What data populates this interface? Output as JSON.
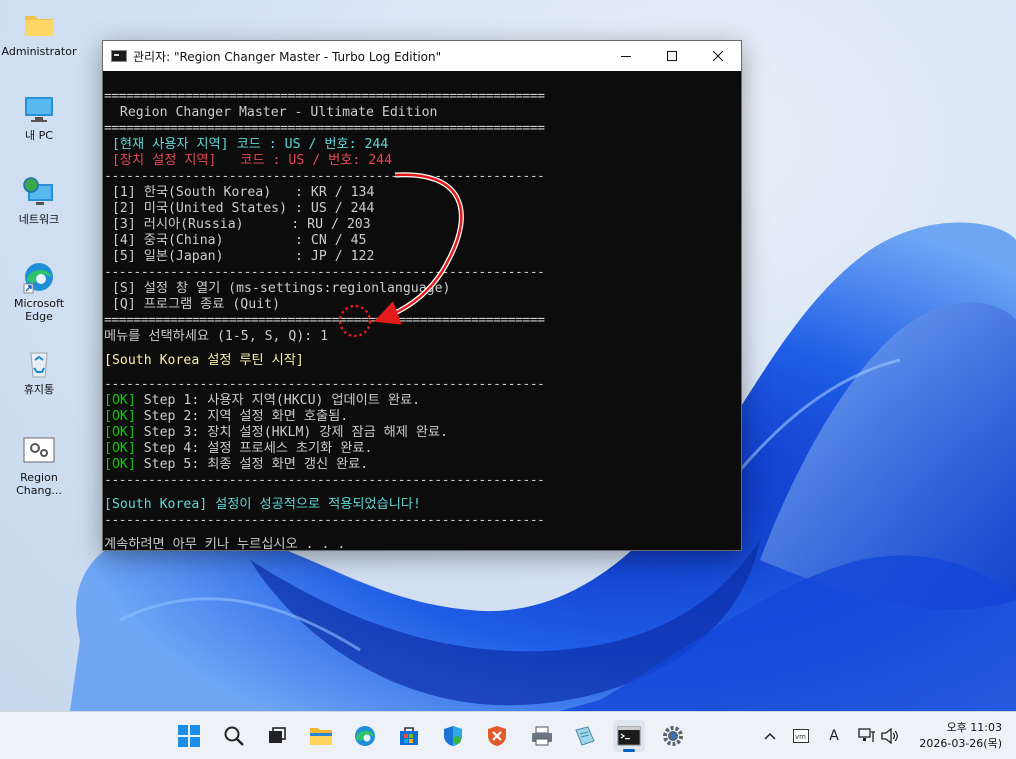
{
  "desktop": {
    "icons": [
      {
        "label": "Administrator"
      },
      {
        "label": "내 PC"
      },
      {
        "label": "네트워크"
      },
      {
        "label": "Microsoft Edge"
      },
      {
        "label": "휴지통"
      },
      {
        "label": "Region Chang..."
      }
    ]
  },
  "window": {
    "title": "관리자:  \"Region Changer Master - Turbo Log Edition\"",
    "controls": [
      "minimize-icon",
      "maximize-icon",
      "close-icon"
    ]
  },
  "terminal": {
    "separator_double": "============================================================",
    "separator_single": "------------------------------------------------------------",
    "header": "  Region Changer Master - Ultimate Edition",
    "current_user": " [현재 사용자 지역] 코드 : US / 번호: 244",
    "current_device": " [장치 설정 지역]   코드 : US / 번호: 244",
    "menu_items": [
      " [1] 한국(South Korea)   : KR / 134",
      " [2] 미국(United States) : US / 244",
      " [3] 러시아(Russia)      : RU / 203",
      " [4] 중국(China)         : CN / 45",
      " [5] 일본(Japan)         : JP / 122"
    ],
    "option_settings": " [S] 설정 창 열기 (ms-settings:regionlanguage)",
    "option_quit": " [Q] 프로그램 종료 (Quit)",
    "prompt": "메뉴를 선택하세요 (1-5, S, Q): ",
    "prompt_input": "1",
    "routine_start": "[South Korea 설정 루틴 시작]",
    "steps": [
      {
        "tag": "[OK]",
        "text": " Step 1: 사용자 지역(HKCU) 업데이트 완료."
      },
      {
        "tag": "[OK]",
        "text": " Step 2: 지역 설정 화면 호출됨."
      },
      {
        "tag": "[OK]",
        "text": " Step 3: 장치 설정(HKLM) 강제 잠금 해제 완료."
      },
      {
        "tag": "[OK]",
        "text": " Step 4: 설정 프로세스 초기화 완료."
      },
      {
        "tag": "[OK]",
        "text": " Step 5: 최종 설정 화면 갱신 완료."
      }
    ],
    "success": "[South Korea] 설정이 성공적으로 적용되었습니다!",
    "continue": "계속하려면 아무 키나 누르십시오 . . ."
  },
  "taskbar": {
    "pinned": [
      "windows-start-icon",
      "search-icon",
      "task-view-icon",
      "file-explorer-icon",
      "edge-icon",
      "store-icon",
      "defender-icon",
      "security-app-icon",
      "printer-icon",
      "notepad-icon",
      "terminal-icon",
      "settings-icon"
    ],
    "tray_ime": "A",
    "clock_time": "오후 11:03",
    "clock_date": "2026-03-26(목)"
  },
  "colors": {
    "terminal_bg": "#0c0c0c",
    "cyan": "#61d6d6",
    "red": "#e74856",
    "yellow": "#f9f1a5",
    "green": "#16c60c",
    "annotation_red": "#e31b1b"
  }
}
